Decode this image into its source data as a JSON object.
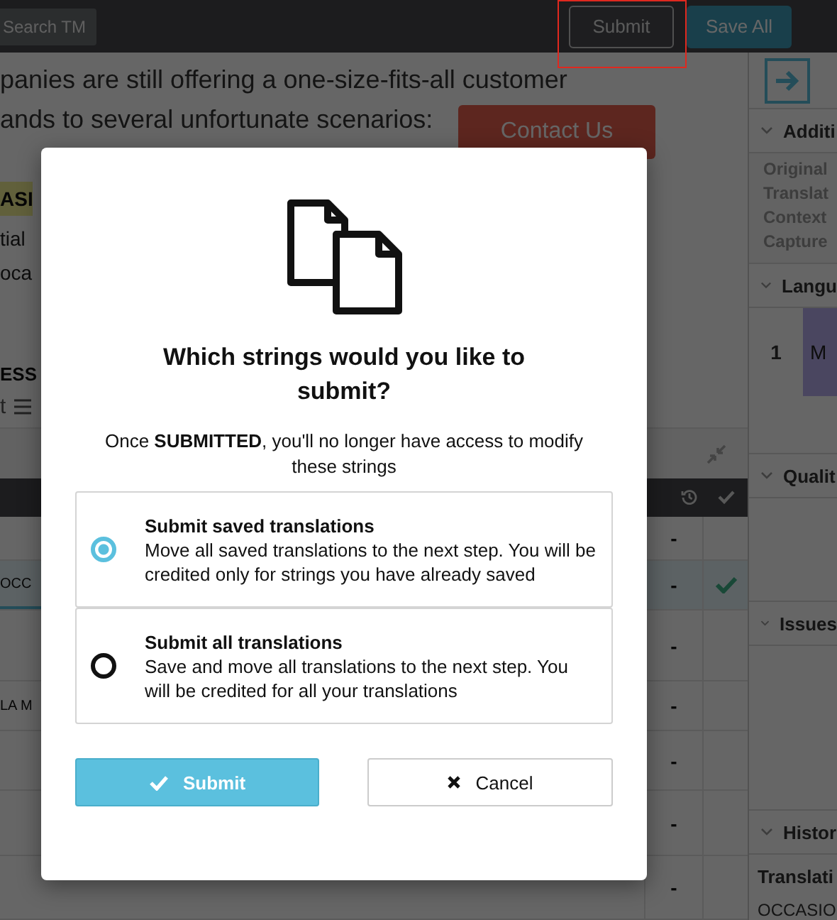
{
  "toolbar": {
    "search_button": "Search TM",
    "submit_button": {
      "label": "Submit",
      "annotated": true
    },
    "save_all_button": "Save All"
  },
  "content": {
    "lines": [
      "panies are still offering a one-size-fits-all customer",
      "ands to several unfortunate scenarios:"
    ],
    "contact_button": "Contact Us",
    "fragments": [
      {
        "text": "ASI",
        "highlighted": true
      },
      {
        "text": "tial",
        "highlighted": false
      },
      {
        "text": "oca",
        "highlighted": false
      }
    ],
    "heading": "ESS",
    "subheading": "t"
  },
  "table": {
    "rows": [
      {
        "value": "-",
        "done": false,
        "selected": false
      },
      {
        "text": "OCC",
        "value": "-",
        "done": true,
        "selected": true
      },
      {
        "value": "-",
        "done": false,
        "selected": false
      },
      {
        "text": "LA M",
        "value": "-",
        "done": false,
        "selected": false
      },
      {
        "value": "-",
        "done": false,
        "selected": false
      },
      {
        "value": "-",
        "done": false,
        "selected": false
      },
      {
        "value": "-",
        "done": false,
        "selected": false
      }
    ]
  },
  "sidebar": {
    "sections": [
      {
        "kind": "fields",
        "title": "Additi",
        "lines": [
          "Original",
          "Translat",
          "Context",
          "Capture"
        ]
      },
      {
        "kind": "language",
        "title": "Langu",
        "index": "1",
        "name": "M"
      },
      {
        "kind": "empty",
        "title": "Qualit"
      },
      {
        "kind": "empty",
        "title": "Issues"
      },
      {
        "kind": "history",
        "title": "Histor",
        "heading": "Translati",
        "lines": [
          "OCCASIO"
        ]
      }
    ]
  },
  "dialog": {
    "title": "Which strings would you like to submit?",
    "message": "Once **SUBMITTED**, you'll no longer have access to modify these strings",
    "options": [
      {
        "title": "Submit saved translations",
        "description": "Move all saved translations to the next step. You will be credited only for strings you have already saved",
        "selected": true
      },
      {
        "title": "Submit all translations",
        "description": "Save and move all translations to the next step. You will be credited for all your translations",
        "selected": false
      }
    ],
    "submit_button": "Submit",
    "cancel_button": "Cancel"
  }
}
